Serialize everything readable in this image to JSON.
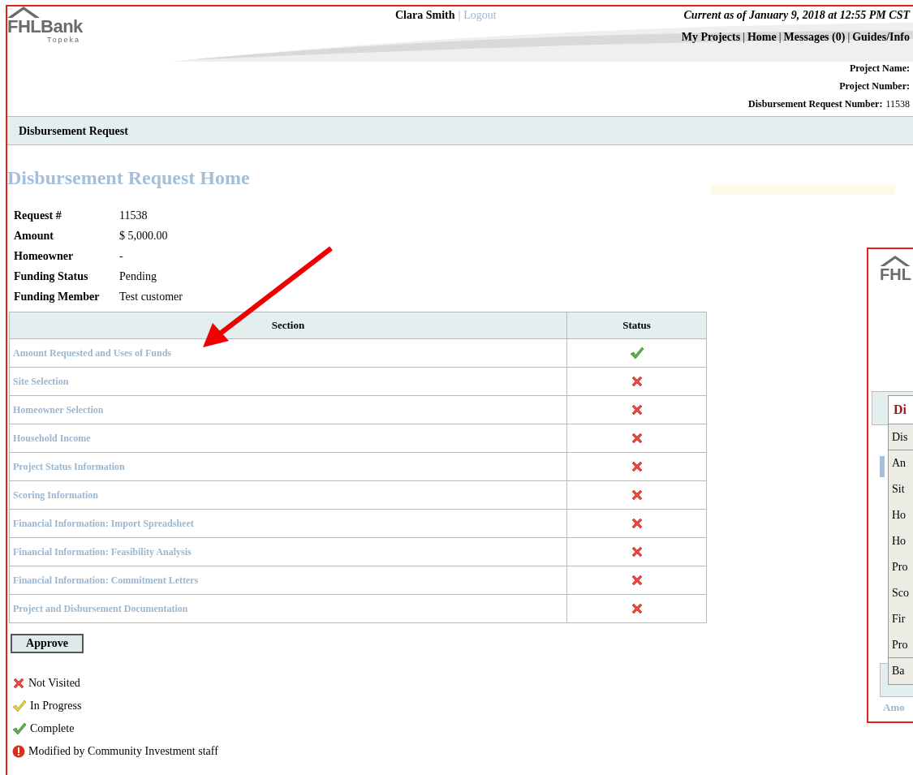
{
  "header": {
    "logo": {
      "name": "FHLBank",
      "sub": "Topeka"
    },
    "user": "Clara Smith",
    "user_separator": "|",
    "logout": "Logout",
    "current_as_of": "Current as of January 9, 2018 at 12:55 PM CST",
    "nav": [
      {
        "label": "My Projects"
      },
      {
        "separator": "|",
        "label": "Home"
      },
      {
        "separator": "|",
        "label": "Messages (0)"
      },
      {
        "separator": "|",
        "label": "Guides/Info"
      }
    ]
  },
  "project_info": [
    {
      "label": "Project Name:"
    },
    {
      "label": "Project Number:"
    },
    {
      "label": "Disbursement Request Number:",
      "value": "11538"
    }
  ],
  "band_title": "Disbursement Request",
  "page_title": "Disbursement Request Home",
  "details": [
    {
      "label": "Request #",
      "value": "11538"
    },
    {
      "label": "Amount",
      "value": "$ 5,000.00"
    },
    {
      "label": "Homeowner",
      "value": "-"
    },
    {
      "label": "Funding Status",
      "value": "Pending"
    },
    {
      "label": "Funding Member",
      "value": "Test customer"
    }
  ],
  "table": {
    "columns": [
      "Section",
      "Status"
    ],
    "rows": [
      {
        "section": "Amount Requested and Uses of Funds",
        "kind": "complete"
      },
      {
        "section": "Site Selection",
        "kind": "not_visited"
      },
      {
        "section": "Homeowner Selection",
        "kind": "not_visited"
      },
      {
        "section": "Household Income",
        "kind": "not_visited"
      },
      {
        "section": "Project Status Information",
        "kind": "not_visited"
      },
      {
        "section": "Scoring Information",
        "kind": "not_visited"
      },
      {
        "section": "Financial Information: Import Spreadsheet",
        "kind": "not_visited"
      },
      {
        "section": "Financial Information: Feasibility Analysis",
        "kind": "not_visited"
      },
      {
        "section": "Financial Information: Commitment Letters",
        "kind": "not_visited"
      },
      {
        "section": "Project and Disbursement Documentation",
        "kind": "not_visited"
      }
    ]
  },
  "approve_button": "Approve",
  "legend": [
    {
      "kind": "not_visited",
      "label": "Not Visited"
    },
    {
      "kind": "in_progress",
      "label": "In Progress"
    },
    {
      "kind": "complete",
      "label": "Complete"
    },
    {
      "kind": "modified",
      "label": "Modified by Community Investment staff"
    }
  ],
  "inset": {
    "logo": "FHL",
    "menu_title": "Di",
    "menu_items": [
      {
        "label": "Dis",
        "separator_after": true
      },
      {
        "label": "An",
        "separator_after": false
      },
      {
        "label": "Sit",
        "separator_after": false
      },
      {
        "label": "Ho",
        "separator_after": false
      },
      {
        "label": "Ho",
        "separator_after": false
      },
      {
        "label": "Pro",
        "separator_after": false
      },
      {
        "label": "Sco",
        "separator_after": false
      },
      {
        "label": "Fir",
        "separator_after": false
      },
      {
        "label": "Pro",
        "separator_after": true
      },
      {
        "label": "Ba",
        "separator_after": false
      }
    ],
    "below": "Amo"
  }
}
